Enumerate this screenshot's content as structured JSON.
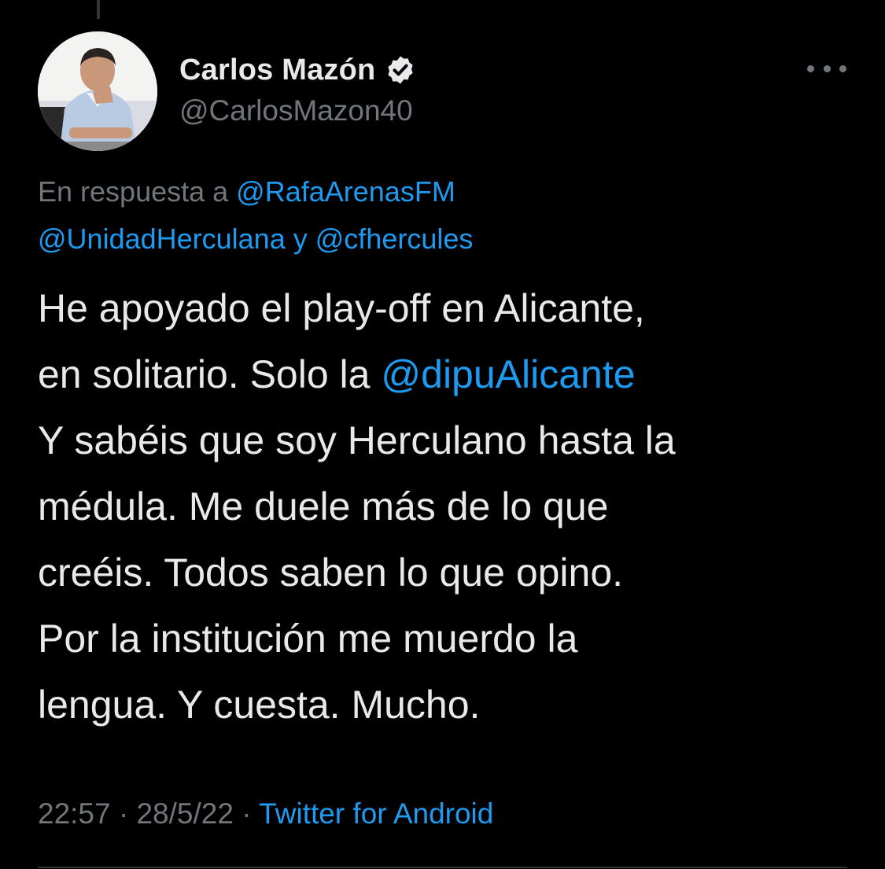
{
  "tweet": {
    "author": {
      "display_name": "Carlos Mazón",
      "handle": "@CarlosMazon40",
      "verified": true,
      "avatar": "profile-photo"
    },
    "reply_to": {
      "prefix": "En respuesta a",
      "mention_1": "@RafaArenasFM",
      "mention_2": "@UnidadHerculana",
      "joiner": "y",
      "mention_3": "@cfhercules"
    },
    "text_lines": {
      "l1": "He apoyado el play-off en Alicante,",
      "l2_pre": "en solitario. Solo la",
      "l2_mention": "@dipuAlicante",
      "l3": "Y sabéis que soy Herculano hasta la",
      "l4": "médula. Me duele más de lo que",
      "l5": "creéis. Todos saben lo que opino.",
      "l6": "Por la institución me muerdo la",
      "l7": "lengua. Y cuesta. Mucho."
    },
    "meta": {
      "time": "22:57",
      "separator": "·",
      "date": "28/5/22",
      "source": "Twitter for Android"
    }
  },
  "icons": {
    "verified": "verified-badge-icon",
    "more": "more-options-icon"
  },
  "colors": {
    "background": "#000000",
    "text_primary": "#e7e9ea",
    "text_secondary": "#71767b",
    "link": "#1d9bf0"
  }
}
